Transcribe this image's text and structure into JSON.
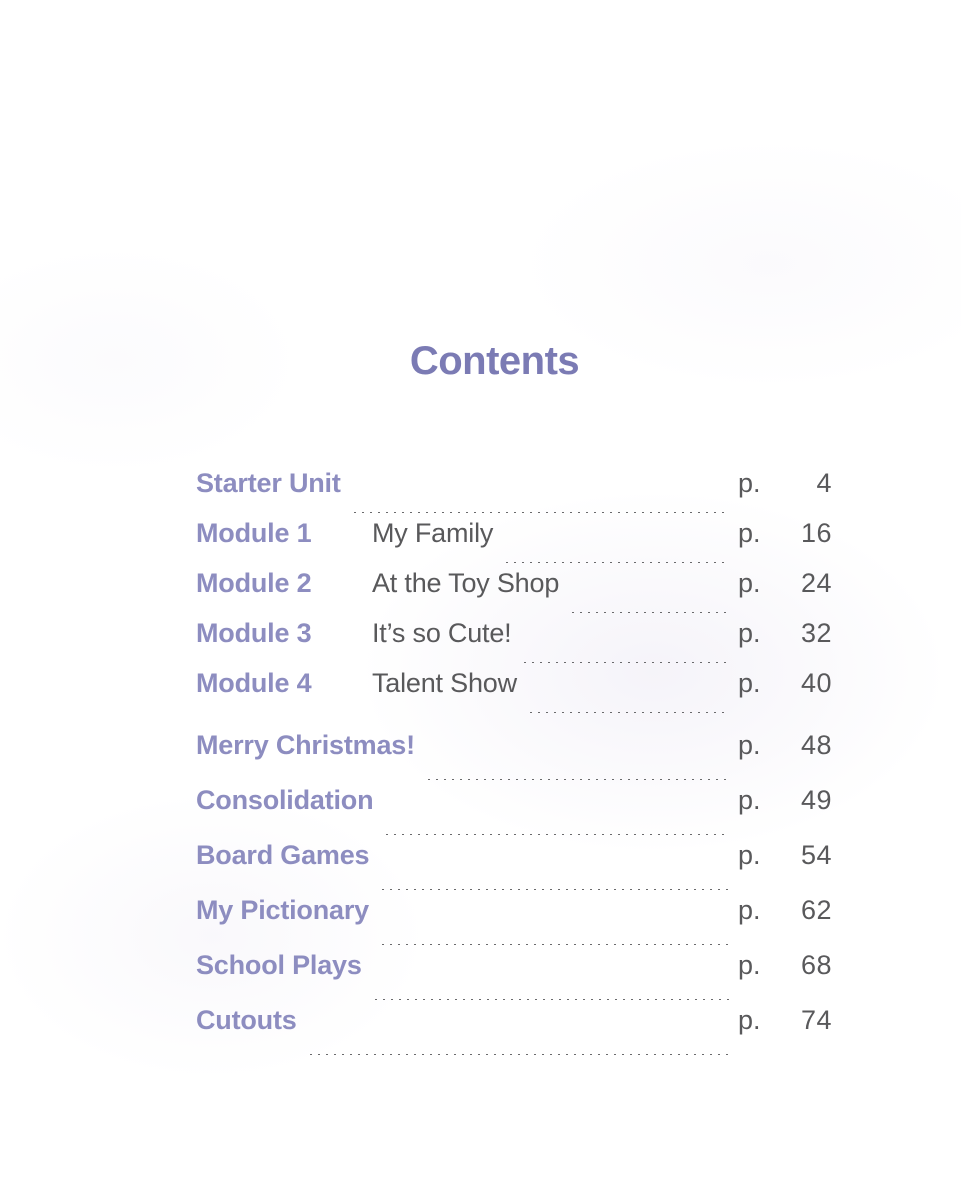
{
  "page": {
    "title": "Contents",
    "background_color": "#ffffff",
    "accent_color": "#8d8dc0",
    "title_color": "#7b7bb4",
    "text_color": "#59595b"
  },
  "toc": {
    "page_marker": "p.",
    "entries": [
      {
        "label": "Starter Unit",
        "subtitle": "",
        "marker": "p.",
        "page": "4",
        "type": "unit"
      },
      {
        "label": "Module 1",
        "subtitle": "My Family",
        "marker": "p.",
        "page": "16",
        "type": "module"
      },
      {
        "label": "Module 2",
        "subtitle": "At the Toy Shop",
        "marker": "p.",
        "page": "24",
        "type": "module"
      },
      {
        "label": "Module 3",
        "subtitle": "It’s so Cute!",
        "marker": "p.",
        "page": "32",
        "type": "module"
      },
      {
        "label": "Module 4",
        "subtitle": "Talent Show",
        "marker": "p.",
        "page": "40",
        "type": "module"
      },
      {
        "label": "Merry Christmas!",
        "subtitle": "",
        "marker": "p.",
        "page": "48",
        "type": "section"
      },
      {
        "label": "Consolidation",
        "subtitle": "",
        "marker": "p.",
        "page": "49",
        "type": "section"
      },
      {
        "label": "Board Games",
        "subtitle": "",
        "marker": "p.",
        "page": "54",
        "type": "section"
      },
      {
        "label": "My Pictionary",
        "subtitle": "",
        "marker": "p.",
        "page": "62",
        "type": "section"
      },
      {
        "label": "School Plays",
        "subtitle": "",
        "marker": "p.",
        "page": "68",
        "type": "section"
      },
      {
        "label": "Cutouts",
        "subtitle": "",
        "marker": "p.",
        "page": "74",
        "type": "section"
      }
    ]
  }
}
